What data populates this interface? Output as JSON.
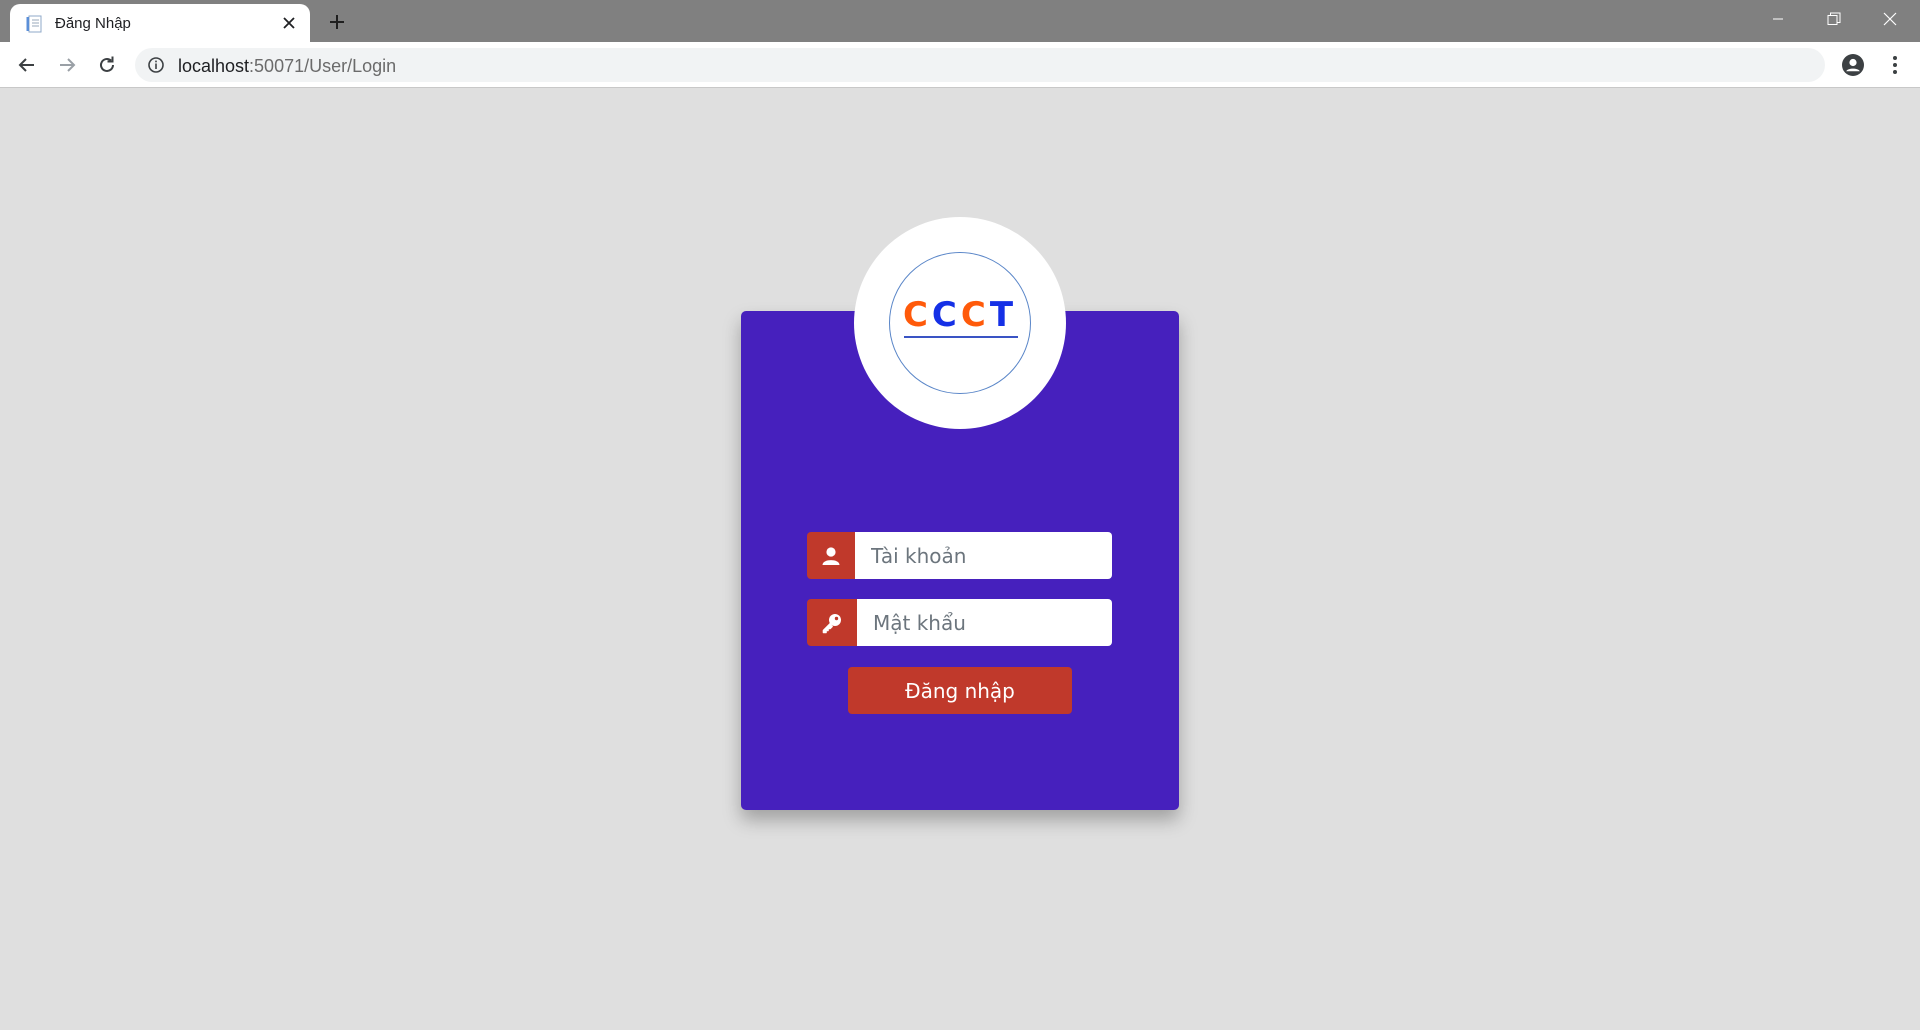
{
  "browser": {
    "tab": {
      "title": "Đăng Nhập"
    },
    "address": {
      "host": "localhost",
      "path": ":50071/User/Login"
    }
  },
  "logo": {
    "letters": [
      {
        "char": "C",
        "color": "#ff5a0a"
      },
      {
        "char": "C",
        "color": "#1530e6"
      },
      {
        "char": "C",
        "color": "#ff5a0a"
      },
      {
        "char": "T",
        "color": "#1530e6"
      }
    ]
  },
  "form": {
    "username": {
      "placeholder": "Tài khoản",
      "icon": "user-icon"
    },
    "password": {
      "placeholder": "Mật khẩu",
      "icon": "key-icon"
    },
    "submit_label": "Đăng nhập"
  },
  "colors": {
    "card_bg": "#4620bd",
    "accent": "#c0392b",
    "page_bg": "#dfdfdf"
  }
}
